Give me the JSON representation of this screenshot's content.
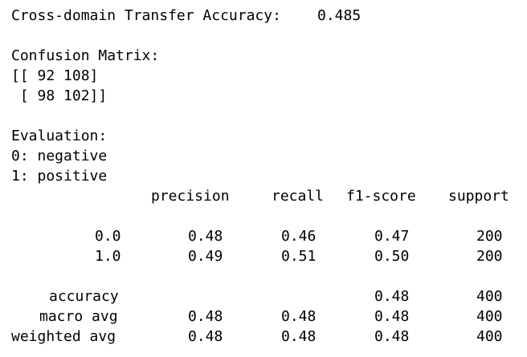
{
  "output": {
    "transfer_accuracy_label": "Cross-domain Transfer Accuracy:",
    "transfer_accuracy_value": "0.485",
    "confusion_matrix_title": "Confusion Matrix:",
    "confusion_matrix_rows": [
      "[[ 92 108]",
      " [ 98 102]]"
    ],
    "evaluation_title": "Evaluation:",
    "label_map": [
      "0: negative",
      "1: positive"
    ]
  },
  "report": {
    "headers": [
      "precision",
      "recall",
      "f1-score",
      "support"
    ],
    "rows": [
      {
        "label": "0.0",
        "precision": "0.48",
        "recall": "0.46",
        "f1": "0.47",
        "support": "200"
      },
      {
        "label": "1.0",
        "precision": "0.49",
        "recall": "0.51",
        "f1": "0.50",
        "support": "200"
      },
      {
        "label": "accuracy",
        "precision": "",
        "recall": "",
        "f1": "0.48",
        "support": "400"
      },
      {
        "label": "macro avg",
        "precision": "0.48",
        "recall": "0.48",
        "f1": "0.48",
        "support": "400"
      },
      {
        "label": "weighted avg",
        "precision": "0.48",
        "recall": "0.48",
        "f1": "0.48",
        "support": "400"
      }
    ]
  }
}
